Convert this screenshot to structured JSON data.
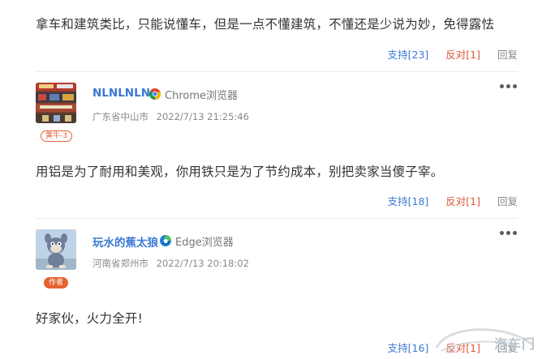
{
  "comments": [
    {
      "text": "拿车和建筑类比，只能说懂车，但是一点不懂建筑，不懂还是少说为妙，免得露怯",
      "support": "支持[23]",
      "oppose": "反对[1]",
      "reply": "回复"
    },
    {
      "username": "NLNLNLN",
      "browser": "Chrome浏览器",
      "browser_icon": "chrome-icon",
      "location": "广东省中山市",
      "datetime": "2022/7/13 21:25:46",
      "badge": "黄牛-3",
      "text": "用铝是为了耐用和美观，你用铁只是为了节约成本，别把卖家当傻子宰。",
      "support": "支持[18]",
      "oppose": "反对[1]",
      "reply": "回复"
    },
    {
      "username": "玩水的蕉太狼",
      "browser": "Edge浏览器",
      "browser_icon": "edge-icon",
      "location": "河南省郑州市",
      "datetime": "2022/7/13 20:18:02",
      "badge": "作者",
      "text": "好家伙，火力全开!",
      "support": "支持[16]",
      "oppose": "反对[1]",
      "reply": "回复"
    }
  ],
  "watermark": {
    "text": "汽车门"
  },
  "colors": {
    "link_blue": "#3d7ad6",
    "oppose_red": "#e0543a",
    "badge_orange": "#e5622e"
  }
}
